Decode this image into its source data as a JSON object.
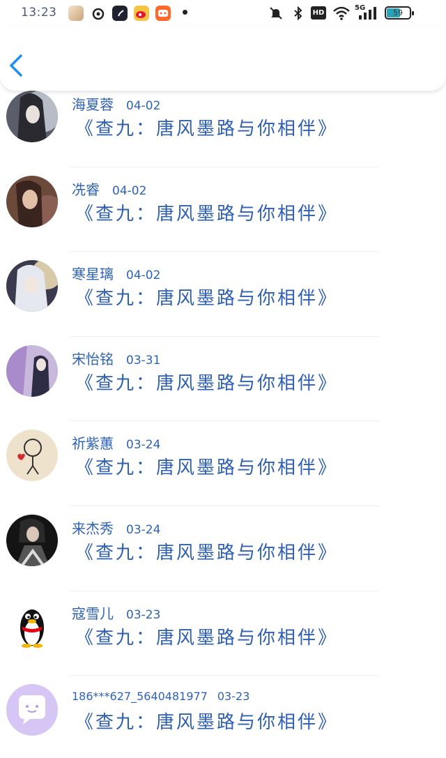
{
  "status_bar": {
    "time": "13:23",
    "network": "5G",
    "battery": "59",
    "hd_label": "HD"
  },
  "header": {
    "back_icon": "chevron-left-icon"
  },
  "messages": [
    {
      "name": "海夏蓉",
      "date": "04-02",
      "text": "《查九：唐风墨路与你相伴》",
      "avatar": "anime-dark-hair"
    },
    {
      "name": "冼睿",
      "date": "04-02",
      "text": "《查九：唐风墨路与你相伴》",
      "avatar": "woman-photo"
    },
    {
      "name": "寒星璃",
      "date": "04-02",
      "text": "《查九：唐风墨路与你相伴》",
      "avatar": "anime-white-hair"
    },
    {
      "name": "宋怡铭",
      "date": "03-31",
      "text": "《查九：唐风墨路与你相伴》",
      "avatar": "wisteria-figure"
    },
    {
      "name": "祈紫蕙",
      "date": "03-24",
      "text": "《查九：唐风墨路与你相伴》",
      "avatar": "sketch-heart"
    },
    {
      "name": "来杰秀",
      "date": "03-24",
      "text": "《查九：唐风墨路与你相伴》",
      "avatar": "game-character"
    },
    {
      "name": "寇雪儿",
      "date": "03-23",
      "text": "《查九：唐风墨路与你相伴》",
      "avatar": "qq-penguin"
    },
    {
      "name": "186***627_5640481977",
      "date": "03-23",
      "text": "《查九：唐风墨路与你相伴》",
      "avatar": "default-chat-bubble"
    }
  ]
}
